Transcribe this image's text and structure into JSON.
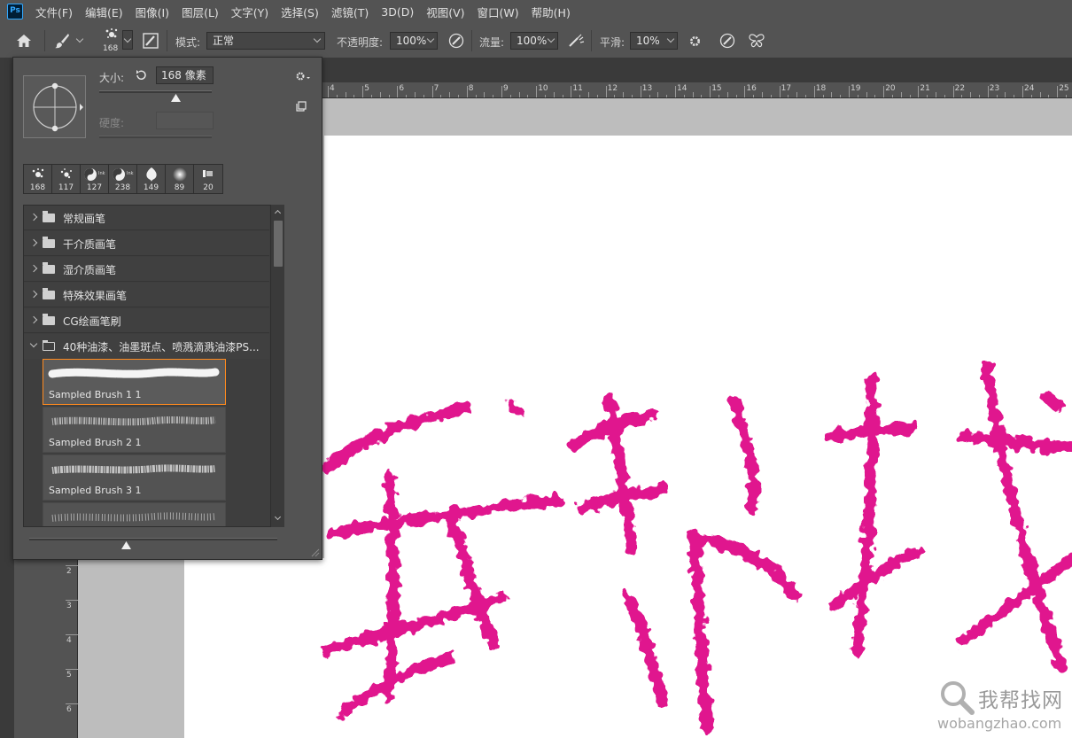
{
  "app": {
    "logo_text": "Ps"
  },
  "menu": [
    "文件(F)",
    "编辑(E)",
    "图像(I)",
    "图层(L)",
    "文字(Y)",
    "选择(S)",
    "滤镜(T)",
    "3D(D)",
    "视图(V)",
    "窗口(W)",
    "帮助(H)"
  ],
  "options_bar": {
    "brush_size": "168",
    "mode_label": "模式:",
    "mode_value": "正常",
    "opacity_label": "不透明度:",
    "opacity_value": "100%",
    "flow_label": "流量:",
    "flow_value": "100%",
    "smoothing_label": "平滑:",
    "smoothing_value": "10%"
  },
  "brush_panel": {
    "size_label": "大小:",
    "size_value": "168 像素",
    "hardness_label": "硬度:",
    "size_slider_fraction": 0.68,
    "preview_slider_fraction": 0.39,
    "recent_brushes": [
      {
        "size": "168",
        "icon": "splatter-icon"
      },
      {
        "size": "117",
        "icon": "splatter-icon"
      },
      {
        "size": "127",
        "icon": "yin-yang-icon"
      },
      {
        "size": "238",
        "icon": "yin-yang-icon"
      },
      {
        "size": "149",
        "icon": "leaf-icon"
      },
      {
        "size": "89",
        "icon": "soft-round-icon"
      },
      {
        "size": "20",
        "icon": "flat-brush-icon"
      }
    ],
    "groups": [
      {
        "name": "常规画笔",
        "open": false
      },
      {
        "name": "干介质画笔",
        "open": false
      },
      {
        "name": "湿介质画笔",
        "open": false
      },
      {
        "name": "特殊效果画笔",
        "open": false
      },
      {
        "name": "CG绘画笔刷",
        "open": false
      },
      {
        "name": "40种油漆、油墨斑点、喷溅滴溅油漆PS...",
        "open": true
      }
    ],
    "presets": [
      {
        "name": "Sampled Brush 1 1",
        "selected": true
      },
      {
        "name": "Sampled Brush 2 1",
        "selected": false
      },
      {
        "name": "Sampled Brush 3 1",
        "selected": false
      },
      {
        "name": "",
        "selected": false
      }
    ]
  },
  "ruler": {
    "top_ticks": [
      "4",
      "5",
      "6",
      "7",
      "8",
      "9",
      "10",
      "11",
      "12",
      "13",
      "14",
      "15",
      "16",
      "17",
      "18",
      "19",
      "20",
      "21",
      "22",
      "23",
      "24",
      "25"
    ],
    "left_ticks": [
      "2",
      "3",
      "4",
      "5",
      "6"
    ]
  },
  "canvas": {
    "paint_color": "#e0168e"
  },
  "watermark": {
    "title": "我帮找网",
    "url": "wobangzhao.com"
  }
}
